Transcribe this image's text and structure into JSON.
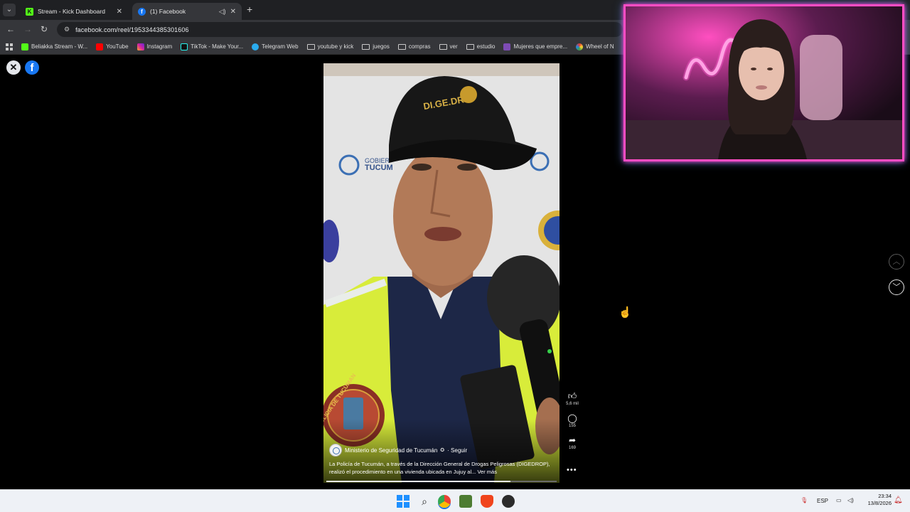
{
  "browser": {
    "tabs": [
      {
        "title": "Stream - Kick Dashboard",
        "favicon": "kick-icon"
      },
      {
        "title": "(1) Facebook",
        "favicon": "facebook-icon",
        "audio": true
      }
    ],
    "new_tab_glyph": "+",
    "url": "facebook.com/reel/1953344385301606",
    "bookmarks": [
      {
        "label": "Beliakka Stream - W...",
        "icon": "kick-icon"
      },
      {
        "label": "YouTube",
        "icon": "youtube-icon"
      },
      {
        "label": "Instagram",
        "icon": "instagram-icon"
      },
      {
        "label": "TikTok - Make Your...",
        "icon": "tiktok-icon"
      },
      {
        "label": "Telegram Web",
        "icon": "telegram-icon"
      },
      {
        "label": "youtube y kick",
        "icon": "folder-icon"
      },
      {
        "label": "juegos",
        "icon": "folder-icon"
      },
      {
        "label": "compras",
        "icon": "folder-icon"
      },
      {
        "label": "ver",
        "icon": "folder-icon"
      },
      {
        "label": "estudio",
        "icon": "folder-icon"
      },
      {
        "label": "Mujeres que empre...",
        "icon": "m-icon"
      },
      {
        "label": "Wheel of N",
        "icon": "wheel-icon"
      }
    ]
  },
  "reel": {
    "author": "Ministerio de Seguridad de Tucumán",
    "follow_label": "· Seguir",
    "caption": "La Policía de Tucumán, a través de la Dirección General de Drogas Peligrosas (DIGEDROP), realizó el procedimiento en una vivienda ubicada en  Jujuy al... Ver más",
    "likes": "5,6 mil",
    "comments": "155",
    "shares": "169",
    "more_glyph": "•••",
    "progress": 0.8,
    "video_text": {
      "cap_text": "DI.GE.DRO",
      "gobierno_text": "GOBIER",
      "tucuman_text": "TUCUM",
      "badge_text": "POLICIA DE TUCUMAN"
    }
  },
  "taskbar": {
    "language": "ESP",
    "time": "23:34",
    "date": "13/8/2026"
  },
  "colors": {
    "facebook_blue": "#1877f2",
    "webcam_border": "#ff4dc4",
    "kick_green": "#53fc18"
  }
}
